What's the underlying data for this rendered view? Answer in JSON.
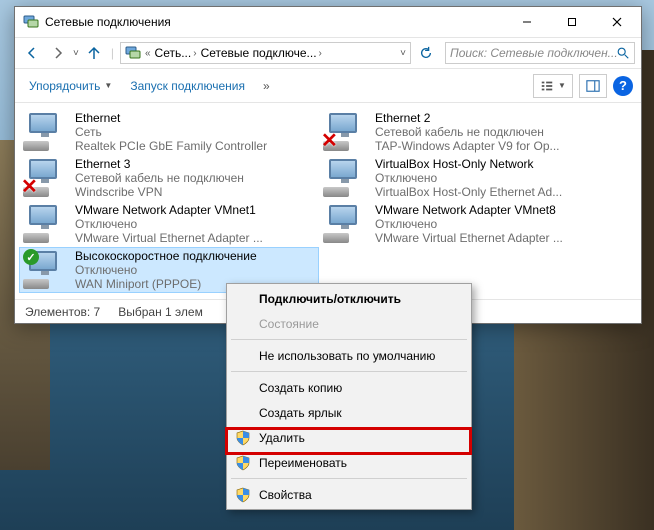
{
  "window": {
    "title": "Сетевые подключения",
    "breadcrumbs": [
      "Сеть...",
      "Сетевые подключе..."
    ],
    "search_placeholder": "Поиск: Сетевые подключен...",
    "organize": "Упорядочить",
    "launch_conn": "Запуск подключения"
  },
  "items": [
    {
      "name": "Ethernet",
      "line2": "Сеть",
      "line3": "Realtek PCIe GbE Family Controller",
      "status": "ok"
    },
    {
      "name": "Ethernet 2",
      "line2": "Сетевой кабель не подключен",
      "line3": "TAP-Windows Adapter V9 for Op...",
      "status": "x"
    },
    {
      "name": "Ethernet 3",
      "line2": "Сетевой кабель не подключен",
      "line3": "Windscribe VPN",
      "status": "x"
    },
    {
      "name": "VirtualBox Host-Only Network",
      "line2": "Отключено",
      "line3": "VirtualBox Host-Only Ethernet Ad...",
      "status": "ok"
    },
    {
      "name": "VMware Network Adapter VMnet1",
      "line2": "Отключено",
      "line3": "VMware Virtual Ethernet Adapter ...",
      "status": "ok"
    },
    {
      "name": "VMware Network Adapter VMnet8",
      "line2": "Отключено",
      "line3": "VMware Virtual Ethernet Adapter ...",
      "status": "ok"
    },
    {
      "name": "Высокоскоростное подключение",
      "line2": "Отключено",
      "line3": "WAN Miniport (PPPOE)",
      "status": "chk",
      "selected": true
    }
  ],
  "status": {
    "count_label": "Элементов: 7",
    "sel_label": "Выбран 1 элем"
  },
  "ctx": {
    "connect": "Подключить/отключить",
    "state": "Состояние",
    "nodefault": "Не использовать по умолчанию",
    "copy": "Создать копию",
    "shortcut": "Создать ярлык",
    "delete": "Удалить",
    "rename": "Переименовать",
    "props": "Свойства"
  }
}
